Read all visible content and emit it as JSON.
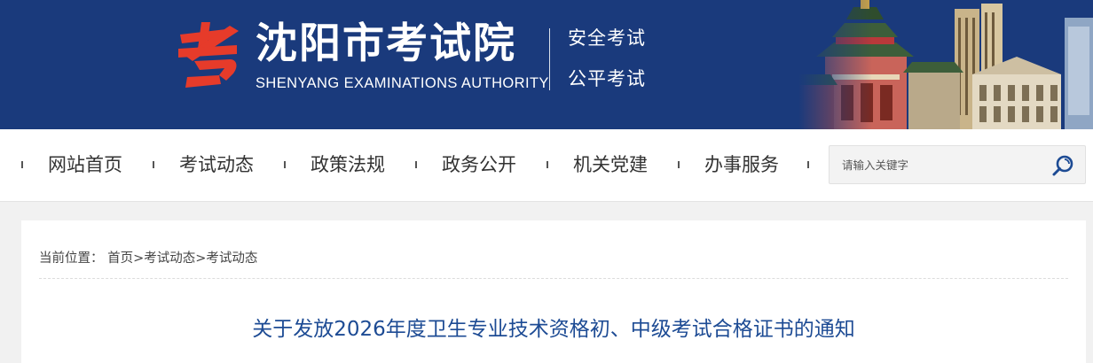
{
  "header": {
    "logo_icon": "shenyang-exam-logo",
    "title": "沈阳市考试院",
    "subtitle": "SHENYANG EXAMINATIONS AUTHORITY",
    "slogans": [
      "安全考试",
      "公平考试"
    ],
    "banner_image": "city-palace-skyline",
    "colors": {
      "banner": "#1a3a7c",
      "logo": "#e63b2a"
    }
  },
  "nav": {
    "items": [
      "网站首页",
      "考试动态",
      "政策法规",
      "政务公开",
      "机关党建",
      "办事服务"
    ],
    "search": {
      "placeholder": "请输入关键字",
      "icon": "search-icon"
    }
  },
  "breadcrumb": {
    "label": "当前位置：",
    "items": [
      "首页",
      "考试动态",
      "考试动态"
    ],
    "separator": ">"
  },
  "article": {
    "title": "关于发放2026年度卫生专业技术资格初、中级考试合格证书的通知",
    "title_color": "#1d4b94"
  }
}
